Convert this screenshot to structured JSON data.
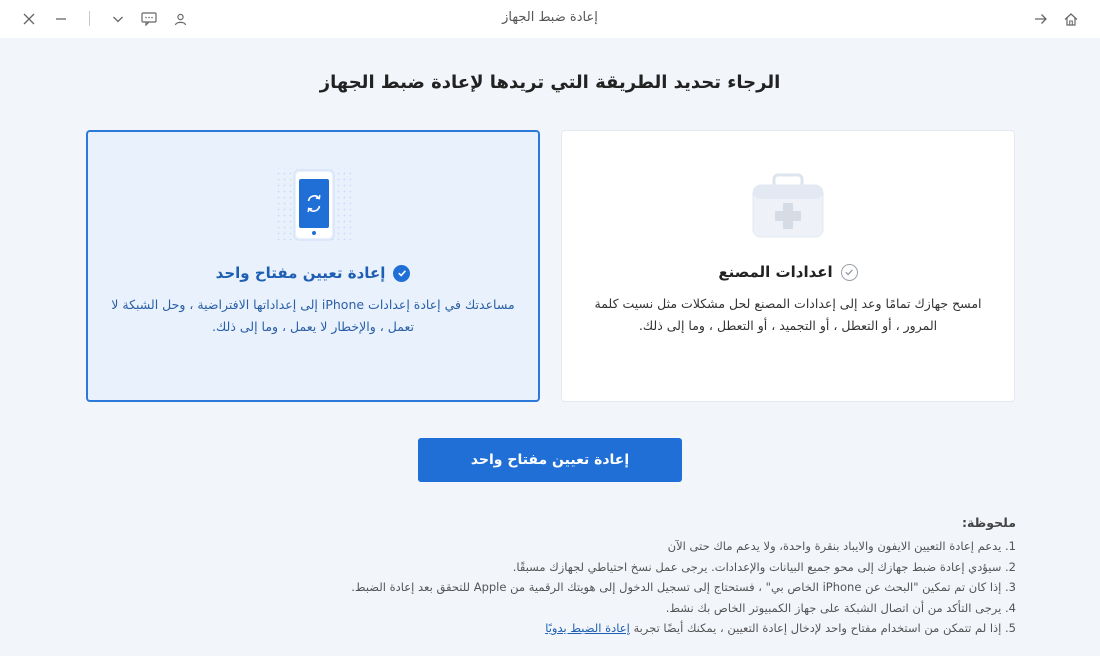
{
  "window": {
    "title": "إعادة ضبط الجهاز",
    "buttons": [
      "close-icon",
      "minimize-icon",
      "chevron-down-icon",
      "feedback-icon",
      "user-icon",
      "back-arrow-icon",
      "home-icon"
    ]
  },
  "main": {
    "heading": "الرجاء تحديد الطريقة التي تريدها لإعادة ضبط الجهاز",
    "options": [
      {
        "title": "إعادة تعيين مفتاح واحد",
        "description": "مساعدتك في إعادة إعدادات iPhone إلى إعداداتها الافتراضية ، وحل الشبكة لا تعمل ، والإخطار لا يعمل ، وما إلى ذلك.",
        "selected": true,
        "icon": "phone-reset-icon"
      },
      {
        "title": "اعدادات المصنع",
        "description": "امسح جهازك تمامًا وعد إلى إعدادات المصنع لحل مشكلات مثل نسيت كلمة المرور ، أو التعطل ، أو التجميد ، أو التعطل ، وما إلى ذلك.",
        "selected": false,
        "icon": "first-aid-kit-icon"
      }
    ],
    "primary_button": "إعادة تعيين مفتاح واحد"
  },
  "notes": {
    "title": "ملحوظة:",
    "items": [
      "1. يدعم إعادة التعيين الايفون والايباد بنقرة واحدة، ولا يدعم ماك حتى الآن",
      "2. سيؤدي إعادة ضبط جهازك إلى محو جميع البيانات والإعدادات. يرجى عمل نسخ احتياطي لجهازك مسبقًا.",
      "3. إذا كان تم تمكين \"البحث عن iPhone الخاص بي\" ، فستحتاج إلى تسجيل الدخول إلى هويتك الرقمية من Apple للتحقق بعد إعادة الضبط.",
      "4. يرجى التأكد من أن اتصال الشبكة على جهاز الكمبيوتر الخاص بك نشط.",
      "5. إذا لم تتمكن من استخدام مفتاح واحد لإدخال إعادة التعيين ، يمكنك أيضًا تجربة"
    ],
    "link": "إعادة الضبط يدويًا"
  },
  "colors": {
    "accent": "#1f6fd6",
    "selected_card_bg": "#e8f1fc",
    "page_bg": "#f2f6fb"
  }
}
